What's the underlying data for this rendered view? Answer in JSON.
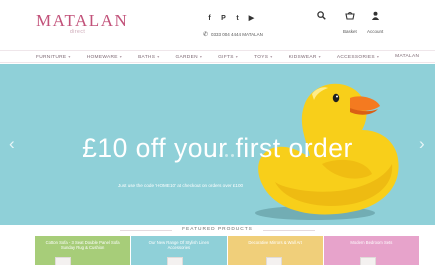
{
  "header": {
    "logo": "MATALAN",
    "logo_sub": "direct",
    "social_icons": [
      "facebook-icon",
      "pinterest-icon",
      "twitter-icon",
      "youtube-icon"
    ],
    "social_glyphs": [
      "f",
      "P",
      "t",
      "▶"
    ],
    "phone": "0333 004 4444 MATALAN",
    "search_label": "",
    "basket_label": "Basket",
    "account_label": "Account"
  },
  "nav": {
    "items": [
      "FURNITURE",
      "HOMEWARE",
      "BATHS",
      "GARDEN",
      "GIFTS",
      "TOYS",
      "KIDSWEAR",
      "ACCESSORIES",
      "MATALAN"
    ]
  },
  "hero": {
    "title": "£10 off your first order",
    "subtitle": "Just use the code 'HOME10' at checkout on orders over £100",
    "bg_color": "#8fd0d8",
    "slides": 4,
    "active_slide": 1
  },
  "featured": {
    "label": "FEATURED PRODUCTS"
  },
  "tiles": [
    {
      "text": "Cotton Sofa - 3 Seat Double Panel Sofa Sunday Rug & Cushion",
      "color": "#a7cd79"
    },
    {
      "text": "Our New Range Of Stylish Linen Accessories",
      "color": "#8fd0d8"
    },
    {
      "text": "Decorative Mirrors & Wall Art",
      "color": "#f0cf7a"
    },
    {
      "text": "Modern Bedroom Sets",
      "color": "#e7a3cb"
    }
  ]
}
